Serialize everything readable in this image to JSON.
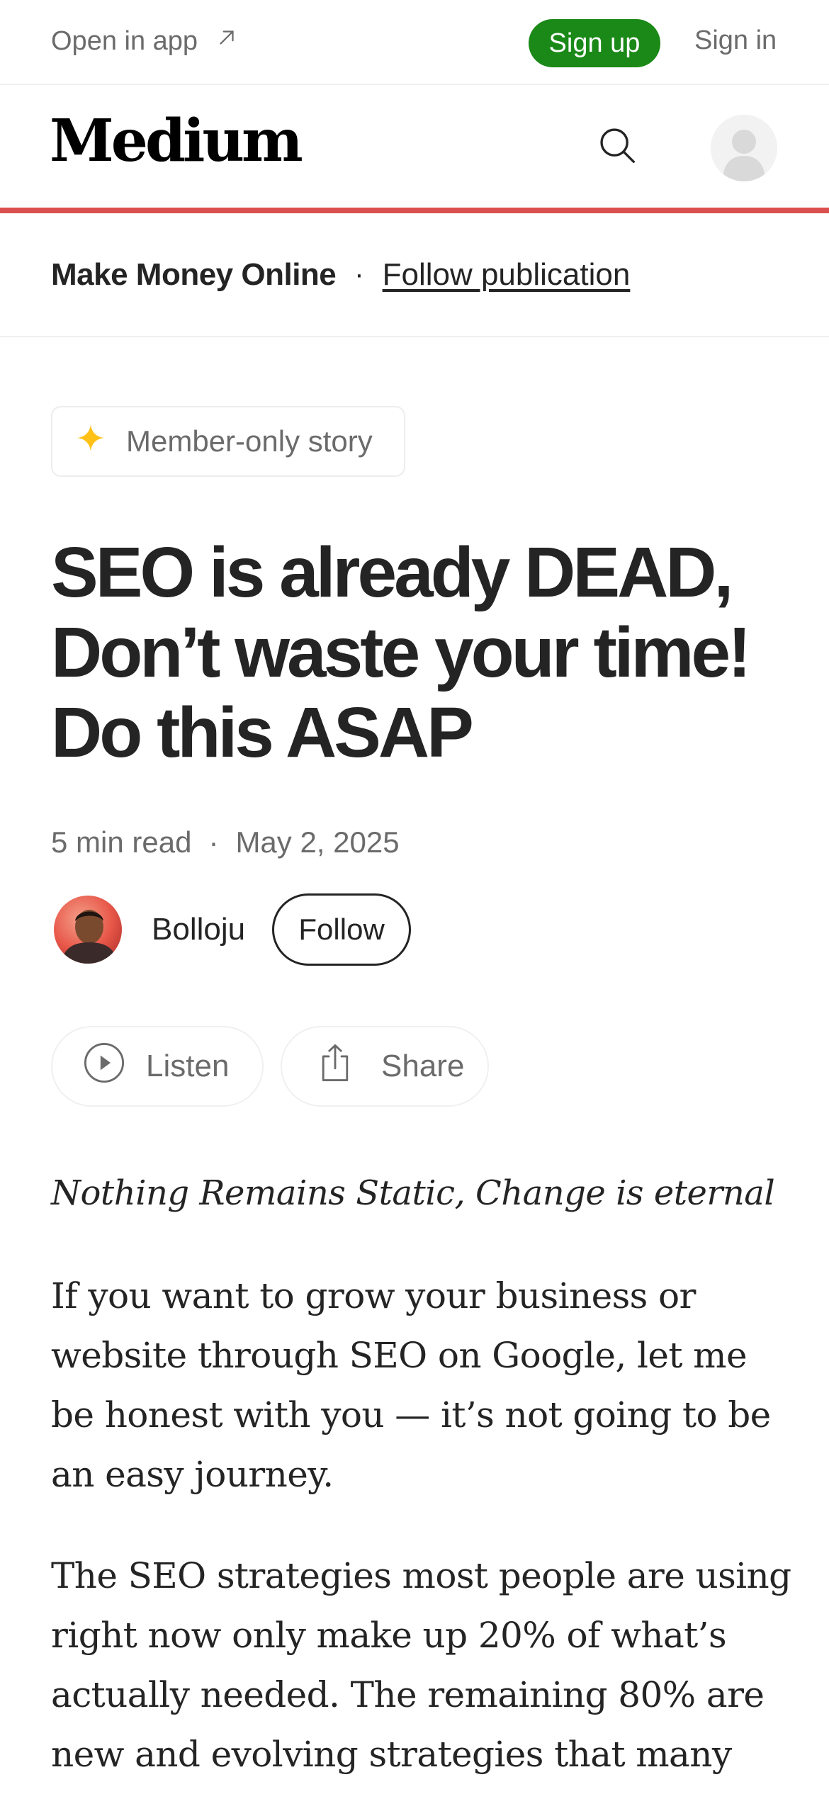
{
  "topbar": {
    "open_in_app": "Open in app",
    "sign_up": "Sign up",
    "sign_in": "Sign in"
  },
  "header": {
    "logo": "Medium",
    "search_icon": "search-icon",
    "avatar_icon": "user-avatar-placeholder",
    "accent_color": "#db4f4f"
  },
  "publication": {
    "name": "Make Money Online",
    "separator": "·",
    "follow_label": "Follow publication"
  },
  "badge": {
    "icon": "star-icon",
    "label": "Member-only story",
    "icon_color": "#ffc017"
  },
  "article": {
    "title": "SEO is already DEAD, Don’t waste your time! Do this ASAP",
    "read_time": "5 min read",
    "separator": "·",
    "date": "May 2, 2025",
    "author": "Bolloju",
    "follow_label": "Follow",
    "listen_label": "Listen",
    "share_label": "Share",
    "subtitle": "Nothing Remains Static, Change is eternal",
    "paragraphs": [
      "If you want to grow your business or website through SEO on Google, let me be honest with you — it’s not going to be an easy journey.",
      "The SEO strategies most people are using right now only make up 20% of what’s actually needed. The remaining 80% are new and evolving strategies that many"
    ]
  },
  "colors": {
    "brand_green": "#1a8917",
    "text_primary": "#242424",
    "text_secondary": "#6b6b6b"
  }
}
